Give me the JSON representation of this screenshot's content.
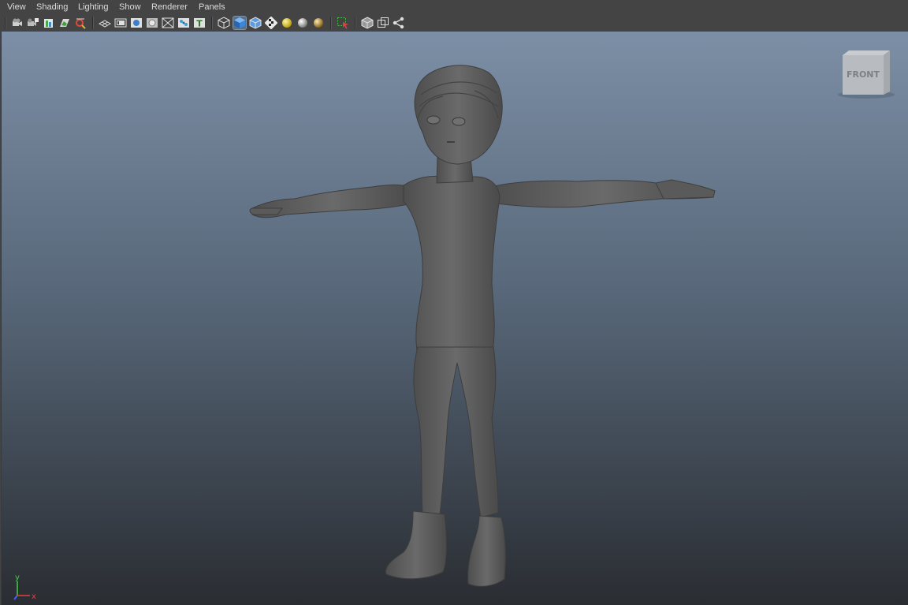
{
  "menus": [
    {
      "id": "view",
      "label": "View"
    },
    {
      "id": "shading",
      "label": "Shading"
    },
    {
      "id": "lighting",
      "label": "Lighting"
    },
    {
      "id": "show",
      "label": "Show"
    },
    {
      "id": "renderer",
      "label": "Renderer"
    },
    {
      "id": "panels",
      "label": "Panels"
    }
  ],
  "toolbar": {
    "icons": [
      "select-camera-icon",
      "camera-attributes-icon",
      "bookmarks-icon",
      "image-plane-icon",
      "2d-pan-zoom-icon",
      "grid-icon",
      "film-gate-icon",
      "resolution-gate-icon",
      "gate-mask-icon",
      "field-chart-icon",
      "safe-action-icon",
      "safe-title-icon",
      "wireframe-icon",
      "smooth-shade-icon",
      "flat-shade-icon",
      "textured-icon",
      "use-all-lights-icon",
      "shadows-icon",
      "ambient-occlusion-icon",
      "isolate-select-icon",
      "xray-icon",
      "xray-active-components-icon",
      "xray-joints-icon"
    ],
    "active_icon": "smooth-shade-icon"
  },
  "viewcube": {
    "label": "FRONT"
  },
  "axis": {
    "y": "y",
    "x": "x"
  },
  "colors": {
    "bg_top": "#7d8fa6",
    "bg_bottom": "#2a2d32",
    "model": "#5f5f5f",
    "axis_x": "#e04040",
    "axis_y": "#40d040",
    "axis_z": "#4060ff"
  }
}
